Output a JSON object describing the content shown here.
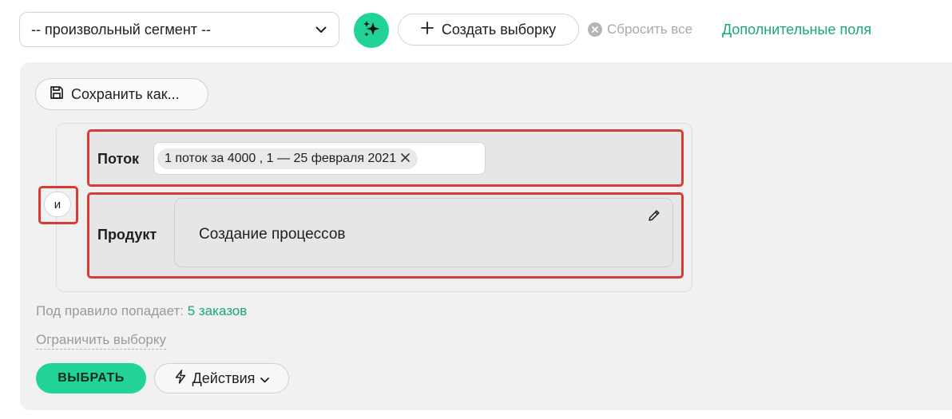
{
  "toolbar": {
    "segment_value": "-- произвольный сегмент --",
    "create_label": "Создать выборку",
    "reset_label": "Сбросить все",
    "extra_fields_label": "Дополнительные поля"
  },
  "panel": {
    "save_as_label": "Сохранить как...",
    "operator": "и",
    "rules": [
      {
        "label": "Поток",
        "tag": "1 поток за 4000 , 1 — 25 февраля 2021"
      },
      {
        "label": "Продукт",
        "value": "Создание процессов"
      }
    ],
    "rule_count_prefix": "Под правило попадает:",
    "rule_count_value": "5 заказов",
    "limit_label": "Ограничить выборку",
    "select_label": "ВЫБРАТЬ",
    "actions_label": "Действия"
  },
  "colors": {
    "accent": "#21d496",
    "link": "#19a872",
    "highlight": "#db3b35",
    "panel_bg": "#f1f1f1"
  },
  "icons": {
    "segment_dropdown": "chevron-down-icon",
    "ai": "sparkles-icon",
    "create": "plus-icon",
    "reset": "close-circle-icon",
    "save": "floppy-disk-icon",
    "tag_remove": "close-icon",
    "edit": "pencil-icon",
    "actions": "lightning-icon",
    "actions_dropdown": "chevron-down-icon"
  }
}
